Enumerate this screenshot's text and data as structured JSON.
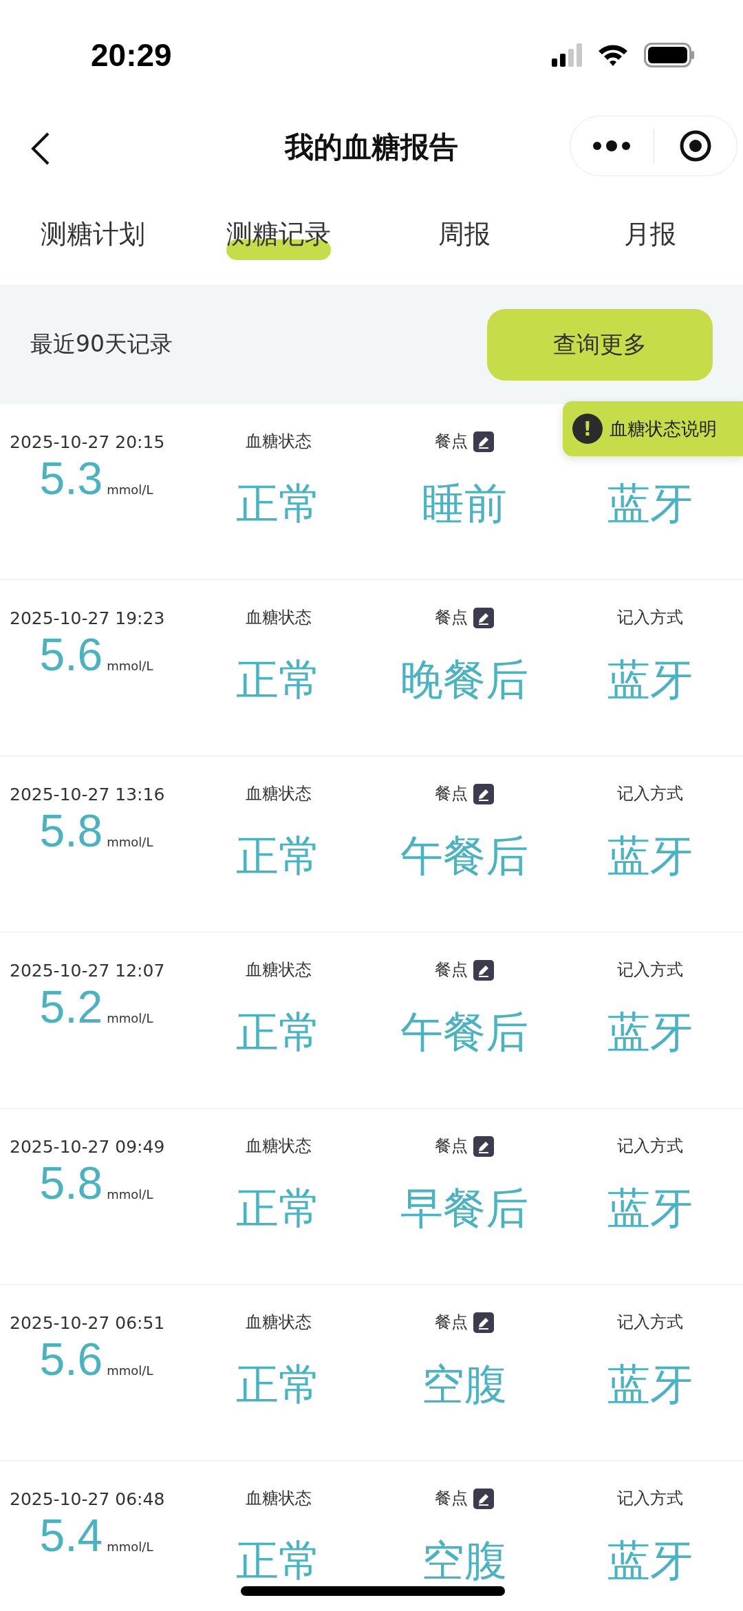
{
  "status_bar": {
    "time": "20:29"
  },
  "nav": {
    "title": "我的血糖报告"
  },
  "tabs": [
    {
      "label": "测糖计划",
      "selected": false
    },
    {
      "label": "测糖记录",
      "selected": true
    },
    {
      "label": "周报",
      "selected": false
    },
    {
      "label": "月报",
      "selected": false
    }
  ],
  "filter": {
    "label": "最近90天记录",
    "button": "查询更多"
  },
  "tooltip": {
    "text": "血糖状态说明",
    "icon": "!"
  },
  "records": [
    {
      "time": "2025-10-27 20:15",
      "value": "5.3",
      "unit": "mmol/L",
      "status_label": "血糖状态",
      "status": "正常",
      "meal_label": "餐点",
      "meal": "睡前",
      "method": "蓝牙"
    },
    {
      "time": "2025-10-27 19:23",
      "value": "5.6",
      "unit": "mmol/L",
      "status_label": "血糖状态",
      "status": "正常",
      "meal_label": "餐点",
      "meal": "晚餐后",
      "method_label": "记入方式",
      "method": "蓝牙"
    },
    {
      "time": "2025-10-27 13:16",
      "value": "5.8",
      "unit": "mmol/L",
      "status_label": "血糖状态",
      "status": "正常",
      "meal_label": "餐点",
      "meal": "午餐后",
      "method_label": "记入方式",
      "method": "蓝牙"
    },
    {
      "time": "2025-10-27 12:07",
      "value": "5.2",
      "unit": "mmol/L",
      "status_label": "血糖状态",
      "status": "正常",
      "meal_label": "餐点",
      "meal": "午餐后",
      "method_label": "记入方式",
      "method": "蓝牙"
    },
    {
      "time": "2025-10-27 09:49",
      "value": "5.8",
      "unit": "mmol/L",
      "status_label": "血糖状态",
      "status": "正常",
      "meal_label": "餐点",
      "meal": "早餐后",
      "method_label": "记入方式",
      "method": "蓝牙"
    },
    {
      "time": "2025-10-27 06:51",
      "value": "5.6",
      "unit": "mmol/L",
      "status_label": "血糖状态",
      "status": "正常",
      "meal_label": "餐点",
      "meal": "空腹",
      "method_label": "记入方式",
      "method": "蓝牙"
    },
    {
      "time": "2025-10-27 06:48",
      "value": "5.4",
      "unit": "mmol/L",
      "status_label": "血糖状态",
      "status": "正常",
      "meal_label": "餐点",
      "meal": "空腹",
      "method_label": "记入方式",
      "method": "蓝牙"
    }
  ]
}
